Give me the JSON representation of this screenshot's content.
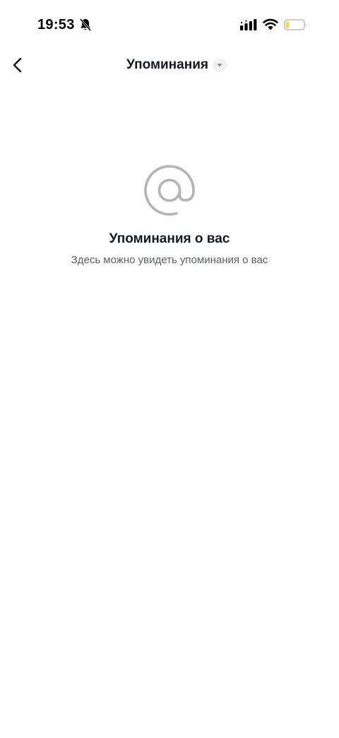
{
  "status_bar": {
    "time": "19:53",
    "icons": [
      "bell-muted-icon",
      "signal-icon",
      "wifi-icon",
      "battery-icon"
    ]
  },
  "nav": {
    "title": "Упоминания",
    "icons": [
      "back-arrow-icon",
      "caret-down-icon"
    ]
  },
  "empty_state": {
    "icon": "at-sign-icon",
    "title": "Упоминания о вас",
    "subtitle": "Здесь можно увидеть упоминания о вас"
  },
  "colors": {
    "background": "#ffffff",
    "text_primary": "#161823",
    "text_secondary": "#5b5d66",
    "icon_gray": "#b4b4b4",
    "battery_low": "#f5d43b"
  }
}
